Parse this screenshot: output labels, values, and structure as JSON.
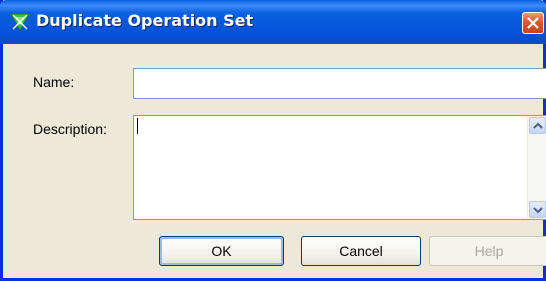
{
  "window": {
    "title": "Duplicate Operation Set",
    "icon": "operation-set-icon"
  },
  "form": {
    "name_label": "Name:",
    "name_value": "",
    "description_label": "Description:",
    "description_value": ""
  },
  "buttons": {
    "ok_label": "OK",
    "cancel_label": "Cancel",
    "help_label": "Help",
    "help_enabled": false
  },
  "colors": {
    "titlebar": "#0a5fe0",
    "dialog_bg": "#ece9d8",
    "close": "#e2572b"
  }
}
